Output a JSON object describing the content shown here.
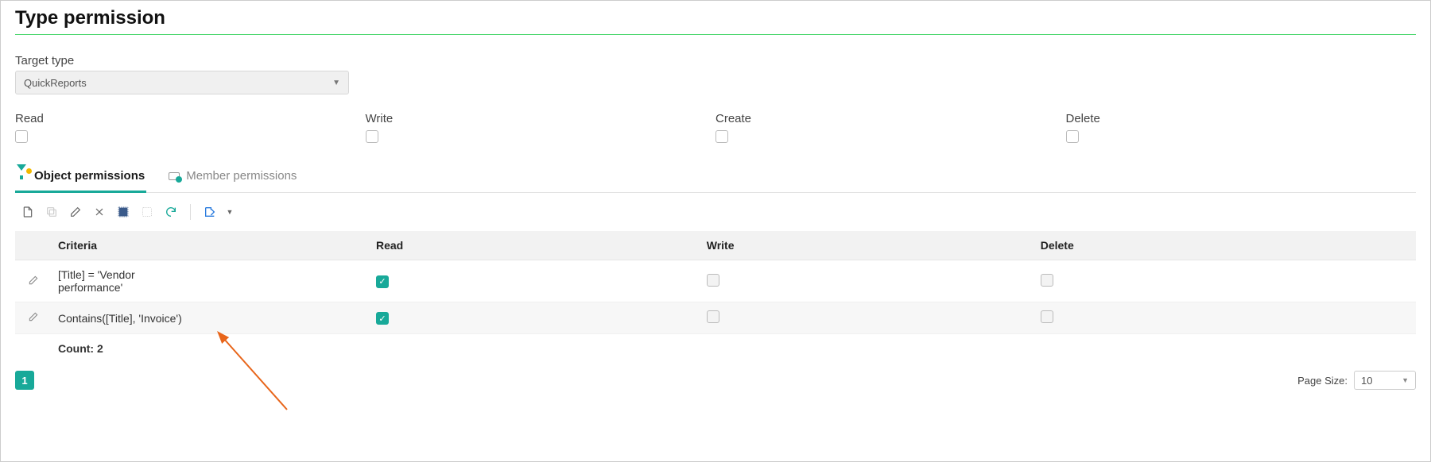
{
  "title": "Type permission",
  "target_type": {
    "label": "Target type",
    "value": "QuickReports"
  },
  "top_permissions": {
    "read": {
      "label": "Read",
      "checked": false
    },
    "write": {
      "label": "Write",
      "checked": false
    },
    "create": {
      "label": "Create",
      "checked": false
    },
    "delete": {
      "label": "Delete",
      "checked": false
    }
  },
  "tabs": {
    "object": "Object permissions",
    "member": "Member permissions",
    "active": "object"
  },
  "grid": {
    "headers": {
      "criteria": "Criteria",
      "read": "Read",
      "write": "Write",
      "delete": "Delete"
    },
    "rows": [
      {
        "criteria": "[Title] = 'Vendor performance'",
        "read": true,
        "write": false,
        "delete": false
      },
      {
        "criteria": "Contains([Title], 'Invoice')",
        "read": true,
        "write": false,
        "delete": false
      }
    ],
    "count_label": "Count:",
    "count_value": "2"
  },
  "pager": {
    "current": "1",
    "page_size_label": "Page Size:",
    "page_size_value": "10"
  }
}
